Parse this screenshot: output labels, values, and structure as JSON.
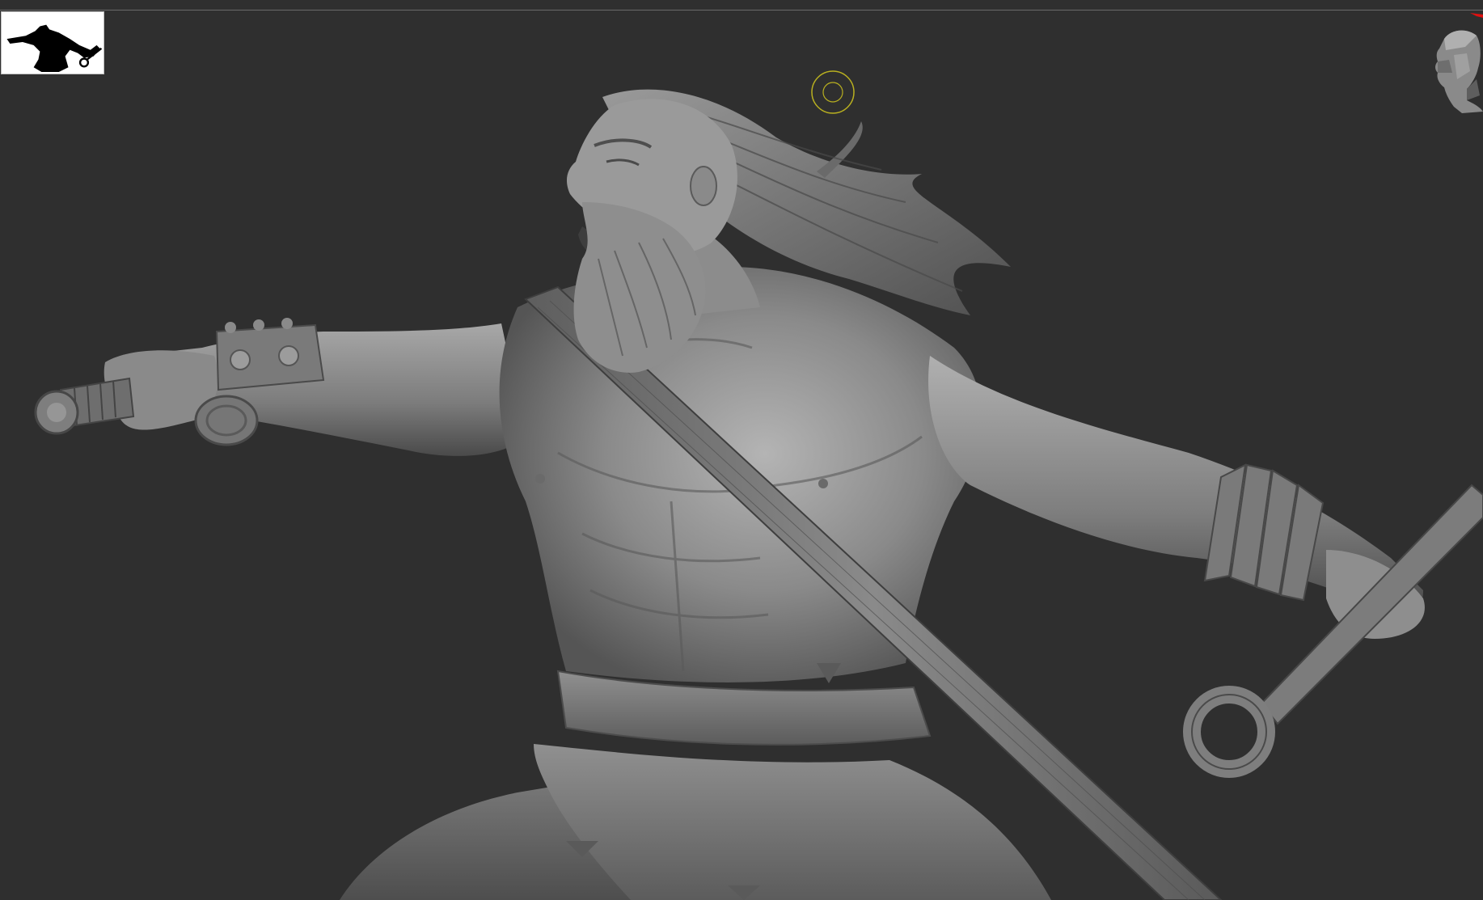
{
  "canvas": {
    "background": "#2f2f2f",
    "rule_color": "#6a6a6a"
  },
  "model": {
    "icon": "sculpted-barbarian-warrior",
    "base_color": "#8c8c8c",
    "shadow_color": "#3e3e3e",
    "highlight_color": "#c6c6c6"
  },
  "thumbnail": {
    "icon": "warrior-silhouette-icon",
    "background": "#ffffff",
    "silhouette_color": "#000000"
  },
  "cursor": {
    "icon": "brush-cursor-icon",
    "color": "#b9b020"
  },
  "navigation": {
    "icon": "head-gizmo-icon",
    "marker_color": "#e01010"
  }
}
